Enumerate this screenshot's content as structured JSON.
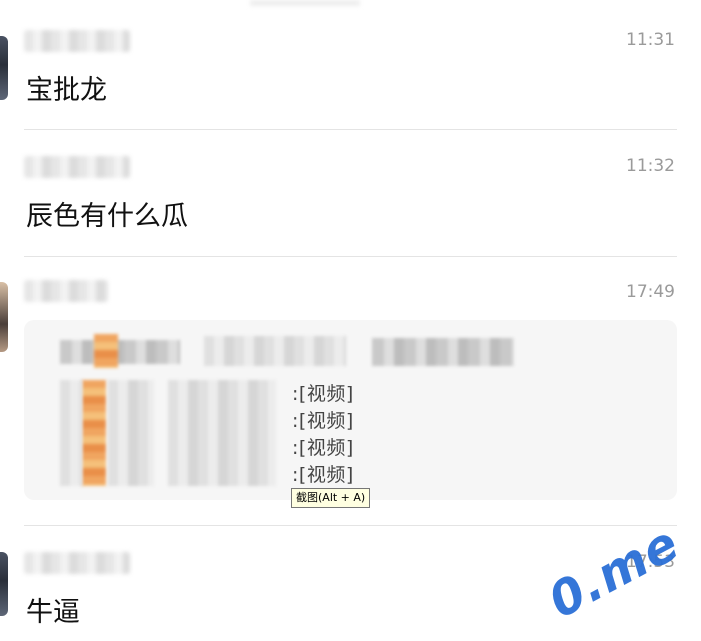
{
  "messages": [
    {
      "time": "11:31",
      "text": "宝批龙"
    },
    {
      "time": "11:32",
      "text": "辰色有什么瓜"
    },
    {
      "time": "17:49",
      "text": ""
    },
    {
      "time": "17:53",
      "text": "牛逼"
    }
  ],
  "quote": {
    "video_items": [
      ":[视频]",
      ":[视频]",
      ":[视频]",
      ":[视频]"
    ]
  },
  "tooltip": "截图(Alt + A)",
  "watermark": "0.me"
}
